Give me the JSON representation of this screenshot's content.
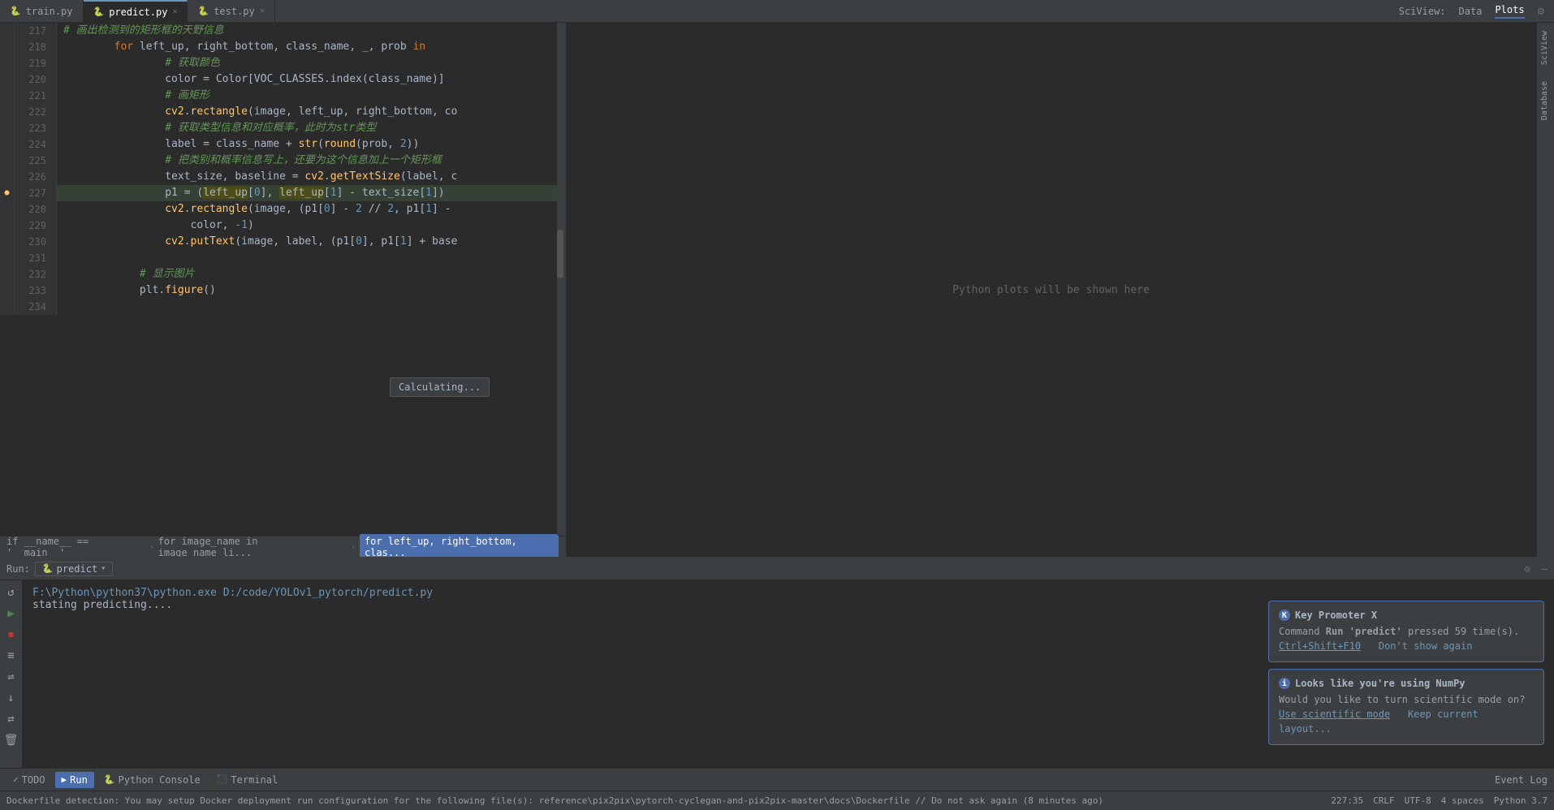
{
  "tabs": [
    {
      "id": "train",
      "label": "train.py",
      "icon": "🐍",
      "active": false
    },
    {
      "id": "predict",
      "label": "predict.py",
      "icon": "🐍",
      "active": true
    },
    {
      "id": "test",
      "label": "test.py",
      "icon": "🐍",
      "active": false
    }
  ],
  "code_lines": [
    {
      "num": "217",
      "code": "            # 画出检测到的矩形框的天野信息",
      "type": "comment"
    },
    {
      "num": "218",
      "code": "            for left_up, right_bottom, class_name, _, prob in",
      "type": "normal"
    },
    {
      "num": "219",
      "code": "                # 获取颜色",
      "type": "comment",
      "indent": true
    },
    {
      "num": "220",
      "code": "                color = Color[VOC_CLASSES.index(class_name)]",
      "type": "normal",
      "indent": true
    },
    {
      "num": "221",
      "code": "                # 画矩形",
      "type": "comment",
      "indent": true
    },
    {
      "num": "222",
      "code": "                cv2.rectangle(image, left_up, right_bottom, co",
      "type": "normal",
      "indent": true
    },
    {
      "num": "223",
      "code": "                # 获取类型信息和对应概率，此时为str类型",
      "type": "comment",
      "indent": true
    },
    {
      "num": "224",
      "code": "                label = class_name + str(round(prob, 2))",
      "type": "normal",
      "indent": true
    },
    {
      "num": "225",
      "code": "                # 把类别和概率信息写上，还要为这个信息加上一个矩形框",
      "type": "comment",
      "indent": true
    },
    {
      "num": "226",
      "code": "                text_size, baseline = cv2.getTextSize(label, c",
      "type": "normal",
      "indent": true
    },
    {
      "num": "227",
      "code": "                p1 = (left_up[0], left_up[1] - text_size[1])",
      "type": "normal",
      "highlight": true,
      "indent": true
    },
    {
      "num": "228",
      "code": "                cv2.rectangle(image, (p1[0] - 2 // 2, p1[1] -",
      "type": "normal",
      "indent": true
    },
    {
      "num": "229",
      "code": "                    color, -1)",
      "type": "normal",
      "indent": true
    },
    {
      "num": "230",
      "code": "                cv2.putText(image, label, (p1[0], p1[1] + base",
      "type": "normal",
      "indent": true
    },
    {
      "num": "231",
      "code": "",
      "type": "normal"
    },
    {
      "num": "232",
      "code": "            # 显示图片",
      "type": "comment",
      "indent": true
    },
    {
      "num": "233",
      "code": "            plt.figure()",
      "type": "normal",
      "indent": true
    },
    {
      "num": "234",
      "code": "",
      "type": "normal"
    }
  ],
  "breadcrumb": {
    "items": [
      "if __name__ == '__main__'",
      "for image_name in image_name_li...",
      "for left_up, right_bottom, clas..."
    ]
  },
  "sciview": {
    "title": "SciView:",
    "tabs": [
      "Data",
      "Plots"
    ],
    "active_tab": "Plots",
    "placeholder": "Python plots will be shown here"
  },
  "run": {
    "label": "Run:",
    "config": "predict",
    "output_path": "F:\\Python\\python37\\python.exe D:/code/YOLOv1_pytorch/predict.py",
    "output_lines": [
      "stating predicting...."
    ]
  },
  "calculating_tooltip": "Calculating...",
  "bottom_tabs": [
    {
      "id": "todo",
      "label": "TODO",
      "icon": "✓",
      "active": false
    },
    {
      "id": "run",
      "label": "Run",
      "icon": "▶",
      "active": true
    },
    {
      "id": "python_console",
      "label": "Python Console",
      "icon": "🐍",
      "active": false
    },
    {
      "id": "terminal",
      "label": "Terminal",
      "icon": "⬛",
      "active": false
    }
  ],
  "event_log": "Event Log",
  "notifications": [
    {
      "id": "key_promoter",
      "icon_type": "blue",
      "icon_label": "K",
      "title": "Key Promoter X",
      "body": "Command Run 'predict' pressed 59 time(s).",
      "links": [
        "Ctrl+Shift+F10",
        "Don't show again"
      ]
    },
    {
      "id": "numpy",
      "icon_type": "blue",
      "icon_label": "i",
      "title": "Looks like you're using NumPy",
      "body": "Would you like to turn scientific mode on?",
      "links": [
        "Use scientific mode",
        "Keep current layout..."
      ]
    }
  ],
  "status_bar": {
    "dockerfile_notice": "Dockerfile detection: You may setup Docker deployment run configuration for the following file(s): reference\\pix2pix\\pytorch-cyclegan-and-pix2pix-master\\docs\\Dockerfile // Do not ask again (8 minutes ago)",
    "position": "227:35",
    "line_endings": "CRLF",
    "encoding": "UTF-8",
    "indent": "4 spaces",
    "language": "Python 3.7"
  },
  "run_toolbar": {
    "buttons": [
      "↺",
      "▶",
      "⏹",
      "≡",
      "≡",
      "↓",
      "⇄",
      "🗑"
    ]
  }
}
